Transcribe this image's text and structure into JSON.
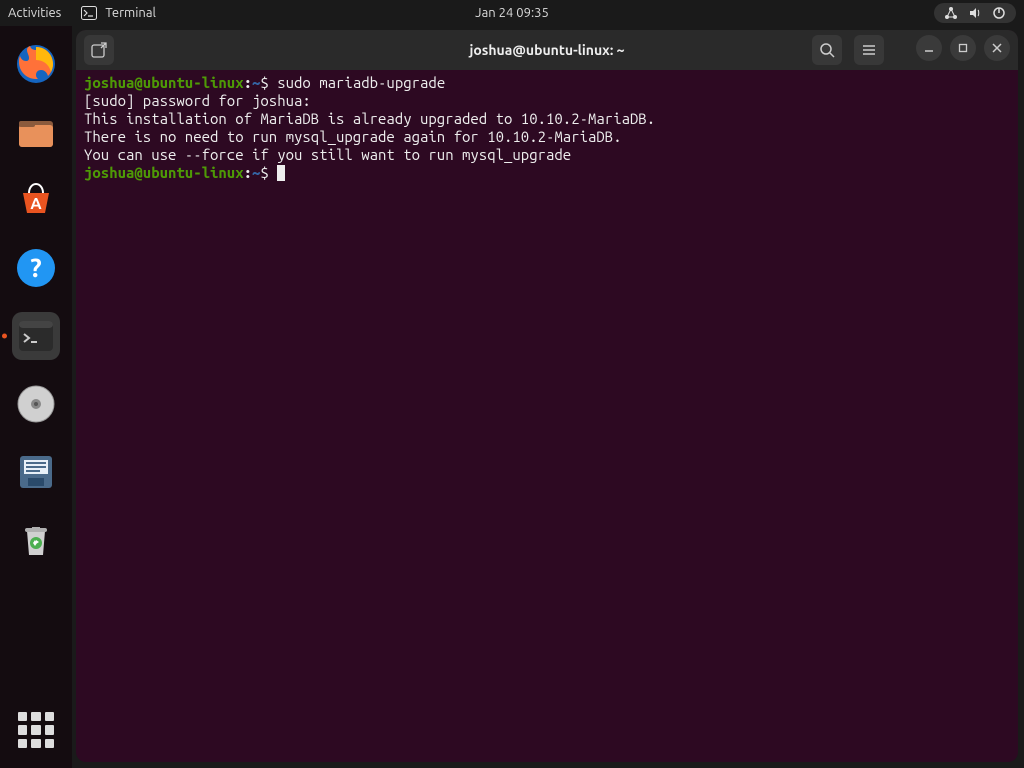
{
  "topbar": {
    "activities": "Activities",
    "app_name": "Terminal",
    "datetime": "Jan 24  09:35"
  },
  "window": {
    "title": "joshua@ubuntu-linux: ~"
  },
  "terminal": {
    "prompt_user_host": "joshua@ubuntu-linux",
    "prompt_path": "~",
    "lines": [
      {
        "type": "cmd",
        "command": "sudo mariadb-upgrade"
      },
      {
        "type": "out",
        "text": "[sudo] password for joshua: "
      },
      {
        "type": "out",
        "text": "This installation of MariaDB is already upgraded to 10.10.2-MariaDB."
      },
      {
        "type": "out",
        "text": "There is no need to run mysql_upgrade again for 10.10.2-MariaDB."
      },
      {
        "type": "out",
        "text": "You can use --force if you still want to run mysql_upgrade"
      },
      {
        "type": "prompt"
      }
    ]
  },
  "dock": {
    "items": [
      {
        "name": "firefox"
      },
      {
        "name": "files"
      },
      {
        "name": "software"
      },
      {
        "name": "help"
      },
      {
        "name": "terminal",
        "active": true
      },
      {
        "name": "disks"
      },
      {
        "name": "save"
      },
      {
        "name": "trash"
      }
    ]
  }
}
